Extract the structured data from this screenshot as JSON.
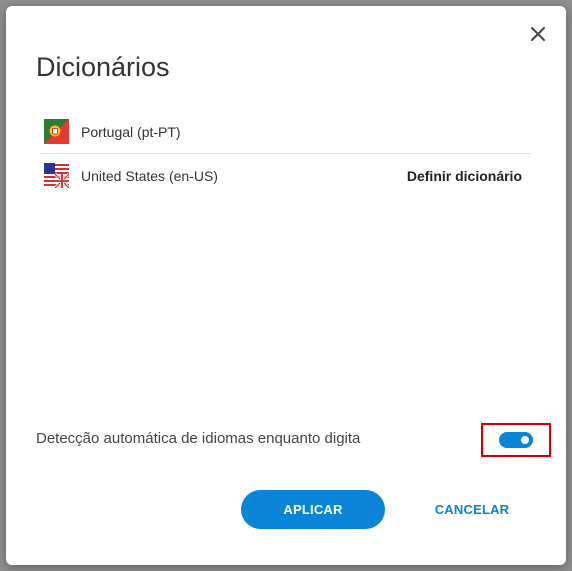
{
  "dialog": {
    "title": "Dicionários",
    "close_icon": "close-icon"
  },
  "dictionaries": [
    {
      "label": "Portugal (pt-PT)",
      "flag_icon": "portugal-flag-icon",
      "action": ""
    },
    {
      "label": "United States (en-US)",
      "flag_icon": "us-flag-icon",
      "action": "Definir dicionário"
    }
  ],
  "auto_detect": {
    "label": "Detecção automática de idiomas enquanto digita",
    "enabled": true
  },
  "buttons": {
    "apply": "APLICAR",
    "cancel": "CANCELAR"
  },
  "colors": {
    "accent": "#0a84d6",
    "highlight_box": "#d40000"
  }
}
